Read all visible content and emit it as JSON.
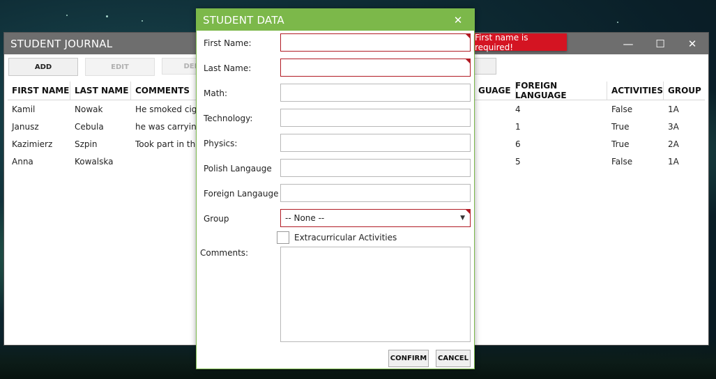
{
  "main": {
    "title": "STUDENT JOURNAL",
    "controls": {
      "minimize": "—",
      "maximize": "☐",
      "close": "✕"
    },
    "toolbar": {
      "add": "ADD",
      "edit": "EDIT",
      "delete": "DEL",
      "partial": "S"
    },
    "columns": [
      "FIRST NAME",
      "LAST NAME",
      "COMMENTS",
      "GUAGE",
      "FOREIGN LANGUAGE",
      "ACTIVITIES",
      "GROUP"
    ],
    "rows": [
      {
        "first": "Kamil",
        "last": "Nowak",
        "comments": "He smoked cigar",
        "foreign": "4",
        "activities": "False",
        "group": "1A"
      },
      {
        "first": "Janusz",
        "last": "Cebula",
        "comments": "he was carrying t",
        "foreign": "1",
        "activities": "True",
        "group": "3A"
      },
      {
        "first": "Kazimierz",
        "last": "Szpin",
        "comments": "Took part in the",
        "foreign": "6",
        "activities": "True",
        "group": "2A"
      },
      {
        "first": "Anna",
        "last": "Kowalska",
        "comments": "",
        "foreign": "5",
        "activities": "False",
        "group": "1A"
      }
    ]
  },
  "dialog": {
    "title": "STUDENT DATA",
    "close": "✕",
    "labels": {
      "first_name": "First Name:",
      "last_name": "Last Name:",
      "math": "Math:",
      "technology": "Technology:",
      "physics": "Physics:",
      "polish": "Polish Langauge",
      "foreign": "Foreign Langauge",
      "group": "Group",
      "activities": "Extracurricular Activities",
      "comments": "Comments:"
    },
    "group_selected": "-- None --",
    "confirm": "CONFIRM",
    "cancel": "CANCEL"
  },
  "tooltip": {
    "text": "First name is required!"
  },
  "colors": {
    "dialog_accent": "#7cb84a",
    "error": "#d41422",
    "title_bar": "#6e6e6e"
  }
}
